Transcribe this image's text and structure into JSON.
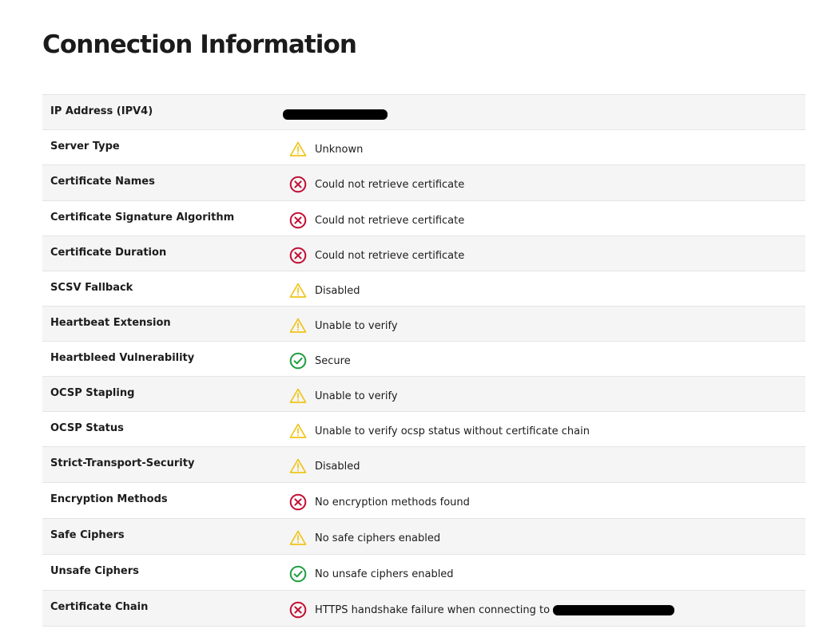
{
  "page": {
    "title": "Connection Information"
  },
  "colors": {
    "warning": "#f0c419",
    "error": "#c20e32",
    "success": "#1e9e3f",
    "row_alt": "#f5f5f5",
    "border": "#e4e4e4"
  },
  "rows": [
    {
      "label": "IP Address (IPV4)",
      "value": "",
      "icon": "none",
      "redacted": true
    },
    {
      "label": "Server Type",
      "value": "Unknown",
      "icon": "warning-icon"
    },
    {
      "label": "Certificate Names",
      "value": "Could not retrieve certificate",
      "icon": "error-icon"
    },
    {
      "label": "Certificate Signature Algorithm",
      "value": "Could not retrieve certificate",
      "icon": "error-icon"
    },
    {
      "label": "Certificate Duration",
      "value": "Could not retrieve certificate",
      "icon": "error-icon"
    },
    {
      "label": "SCSV Fallback",
      "value": "Disabled",
      "icon": "warning-icon"
    },
    {
      "label": "Heartbeat Extension",
      "value": "Unable to verify",
      "icon": "warning-icon"
    },
    {
      "label": "Heartbleed Vulnerability",
      "value": "Secure",
      "icon": "success-icon"
    },
    {
      "label": "OCSP Stapling",
      "value": "Unable to verify",
      "icon": "warning-icon"
    },
    {
      "label": "OCSP Status",
      "value": "Unable to verify ocsp status without certificate chain",
      "icon": "warning-icon"
    },
    {
      "label": "Strict-Transport-Security",
      "value": "Disabled",
      "icon": "warning-icon"
    },
    {
      "label": "Encryption Methods",
      "value": "No encryption methods found",
      "icon": "error-icon"
    },
    {
      "label": "Safe Ciphers",
      "value": "No safe ciphers enabled",
      "icon": "warning-icon"
    },
    {
      "label": "Unsafe Ciphers",
      "value": "No unsafe ciphers enabled",
      "icon": "success-icon"
    },
    {
      "label": "Certificate Chain",
      "value": "HTTPS handshake failure when connecting to",
      "icon": "error-icon",
      "redacted_suffix": true
    }
  ]
}
